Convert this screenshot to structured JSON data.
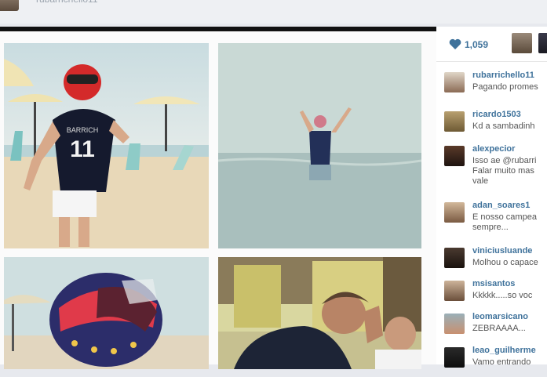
{
  "header": {
    "username": "rubarrichello11"
  },
  "post": {
    "likes": "1,059",
    "comments": [
      {
        "user": "rubarrichello11",
        "text": "Pagando promes"
      },
      {
        "user": "ricardo1503",
        "text": "Kd a sambadinh"
      },
      {
        "user": "alexpecior",
        "text": "Isso ae @rubarri\nFalar muito mas\nvale"
      },
      {
        "user": "adan_soares1",
        "text": "E nosso campea\nsempre..."
      },
      {
        "user": "viniciusluande",
        "text": "Molhou o capace"
      },
      {
        "user": "msisantos",
        "text": "Kkkkk.....so voc"
      },
      {
        "user": "leomarsicano",
        "text": "ZEBRAAAA..."
      },
      {
        "user": "leao_guilherme",
        "text": "Vamo entrando"
      }
    ]
  },
  "photos": {
    "jersey_name": "BARRICH",
    "jersey_number": "11"
  },
  "colors": {
    "username_blue": "#3f729b",
    "heart_blue": "#3f729b",
    "top_strip": "#111111"
  }
}
